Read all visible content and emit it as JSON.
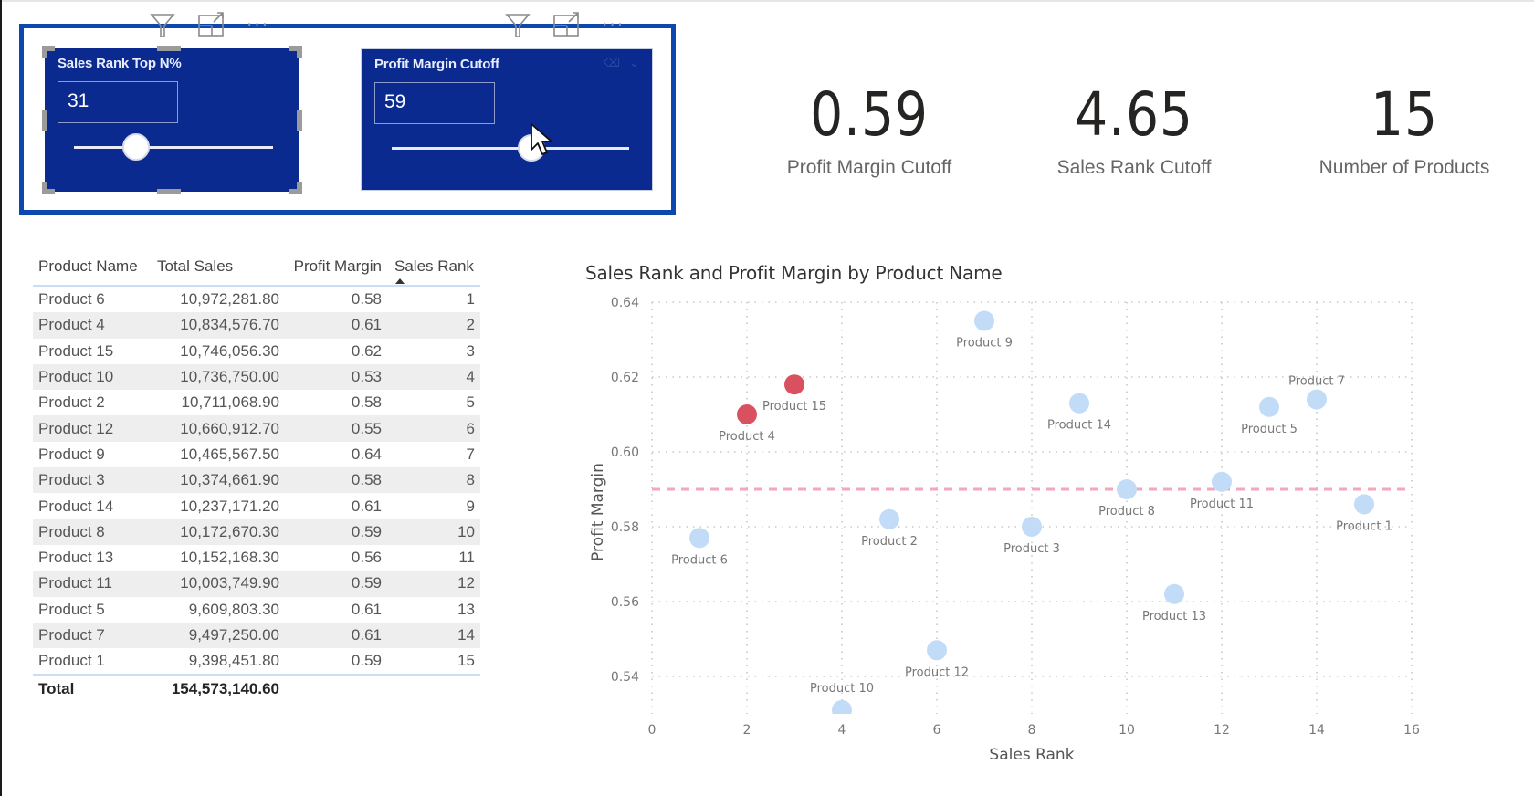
{
  "slicers": [
    {
      "title": "Sales Rank Top N%",
      "value": "31",
      "slider_fraction": 0.31,
      "selected": true
    },
    {
      "title": "Profit Margin Cutoff",
      "value": "59",
      "slider_fraction": 0.59,
      "selected": false
    }
  ],
  "header_icons": [
    "filter-icon",
    "focus-mode-icon",
    "more-options-icon"
  ],
  "kpis": [
    {
      "value": "0.59",
      "label": "Profit Margin Cutoff"
    },
    {
      "value": "4.65",
      "label": "Sales Rank Cutoff"
    },
    {
      "value": "15",
      "label": "Number of Products"
    }
  ],
  "table": {
    "columns": [
      "Product Name",
      "Total Sales",
      "Profit Margin",
      "Sales Rank"
    ],
    "sort_column": "Sales Rank",
    "sort_direction": "ascending",
    "rows": [
      [
        "Product 6",
        "10,972,281.80",
        "0.58",
        "1"
      ],
      [
        "Product 4",
        "10,834,576.70",
        "0.61",
        "2"
      ],
      [
        "Product 15",
        "10,746,056.30",
        "0.62",
        "3"
      ],
      [
        "Product 10",
        "10,736,750.00",
        "0.53",
        "4"
      ],
      [
        "Product 2",
        "10,711,068.90",
        "0.58",
        "5"
      ],
      [
        "Product 12",
        "10,660,912.70",
        "0.55",
        "6"
      ],
      [
        "Product 9",
        "10,465,567.50",
        "0.64",
        "7"
      ],
      [
        "Product 3",
        "10,374,661.90",
        "0.58",
        "8"
      ],
      [
        "Product 14",
        "10,237,171.20",
        "0.61",
        "9"
      ],
      [
        "Product 8",
        "10,172,670.30",
        "0.59",
        "10"
      ],
      [
        "Product 13",
        "10,152,168.30",
        "0.56",
        "11"
      ],
      [
        "Product 11",
        "10,003,749.90",
        "0.59",
        "12"
      ],
      [
        "Product 5",
        "9,609,803.30",
        "0.61",
        "13"
      ],
      [
        "Product 7",
        "9,497,250.00",
        "0.61",
        "14"
      ],
      [
        "Product 1",
        "9,398,451.80",
        "0.59",
        "15"
      ]
    ],
    "total": {
      "label": "Total",
      "total_sales": "154,573,140.60"
    }
  },
  "chart_data": {
    "type": "scatter",
    "title": "Sales Rank and Profit Margin by Product Name",
    "xlabel": "Sales Rank",
    "ylabel": "Profit Margin",
    "xlim": [
      0,
      16
    ],
    "ylim": [
      0.53,
      0.64
    ],
    "x_ticks": [
      "0",
      "2",
      "4",
      "6",
      "8",
      "10",
      "12",
      "14",
      "16"
    ],
    "y_ticks": [
      "0.54",
      "0.56",
      "0.58",
      "0.60",
      "0.62",
      "0.64"
    ],
    "grid": true,
    "reference_line": {
      "axis": "y",
      "value": 0.59,
      "color": "#f4a6bd",
      "style": "dashed"
    },
    "colors": {
      "default": "#c2dcf7",
      "highlight": "#d9505f"
    },
    "points": [
      {
        "name": "Product 6",
        "x": 1,
        "y": 0.577,
        "highlight": false
      },
      {
        "name": "Product 4",
        "x": 2,
        "y": 0.61,
        "highlight": true
      },
      {
        "name": "Product 15",
        "x": 3,
        "y": 0.618,
        "highlight": true
      },
      {
        "name": "Product 10",
        "x": 4,
        "y": 0.531,
        "highlight": false
      },
      {
        "name": "Product 2",
        "x": 5,
        "y": 0.582,
        "highlight": false
      },
      {
        "name": "Product 12",
        "x": 6,
        "y": 0.547,
        "highlight": false
      },
      {
        "name": "Product 9",
        "x": 7,
        "y": 0.635,
        "highlight": false
      },
      {
        "name": "Product 3",
        "x": 8,
        "y": 0.58,
        "highlight": false
      },
      {
        "name": "Product 14",
        "x": 9,
        "y": 0.613,
        "highlight": false
      },
      {
        "name": "Product 8",
        "x": 10,
        "y": 0.59,
        "highlight": false
      },
      {
        "name": "Product 13",
        "x": 11,
        "y": 0.562,
        "highlight": false
      },
      {
        "name": "Product 11",
        "x": 12,
        "y": 0.592,
        "highlight": false
      },
      {
        "name": "Product 5",
        "x": 13,
        "y": 0.612,
        "highlight": false
      },
      {
        "name": "Product 7",
        "x": 14,
        "y": 0.614,
        "highlight": false
      },
      {
        "name": "Product 1",
        "x": 15,
        "y": 0.586,
        "highlight": false
      }
    ]
  }
}
